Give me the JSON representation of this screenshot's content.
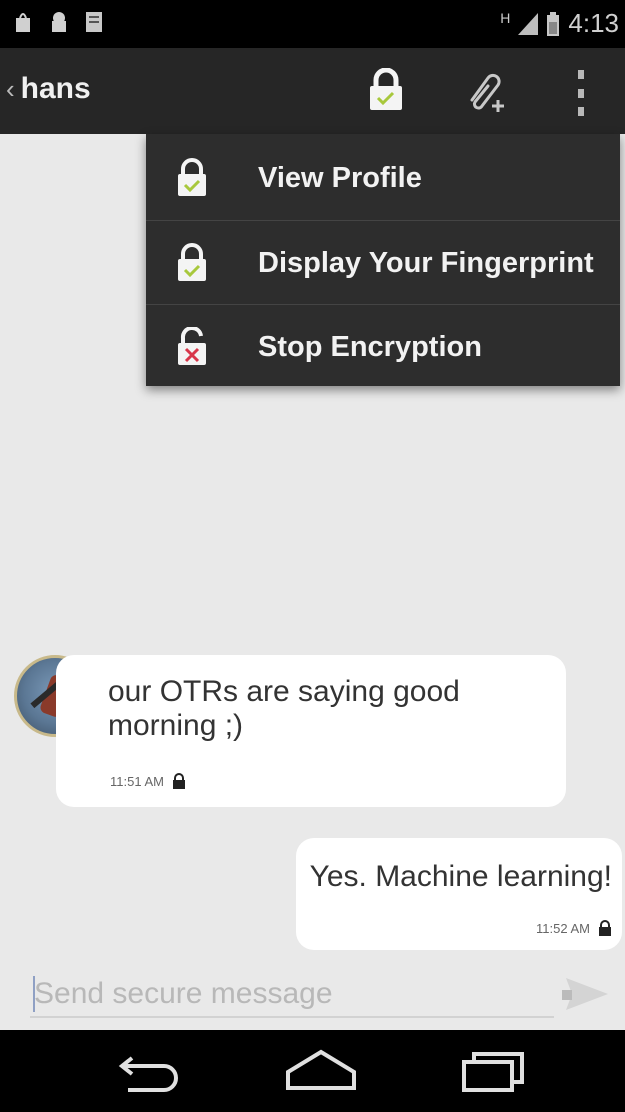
{
  "status_bar": {
    "network_type": "H",
    "time": "4:13"
  },
  "action_bar": {
    "contact_name": "hans"
  },
  "menu": {
    "items": [
      {
        "label": "View Profile",
        "icon": "lock-check-icon"
      },
      {
        "label": "Display Your Fingerprint",
        "icon": "lock-check-icon"
      },
      {
        "label": "Stop Encryption",
        "icon": "unlock-x-icon"
      }
    ]
  },
  "messages": [
    {
      "direction": "incoming",
      "text": "our OTRs are saying good morning ;)",
      "time": "11:51 AM"
    },
    {
      "direction": "outgoing",
      "text": "Yes. Machine learning!",
      "time": "11:52 AM"
    }
  ],
  "compose": {
    "placeholder": "Send secure message"
  },
  "colors": {
    "action_bar": "#262626",
    "menu_bg": "#2d2d2d",
    "chat_bg": "#e9e9e9",
    "lock_check": "#a8c83c",
    "unlock_x": "#d8364a"
  }
}
